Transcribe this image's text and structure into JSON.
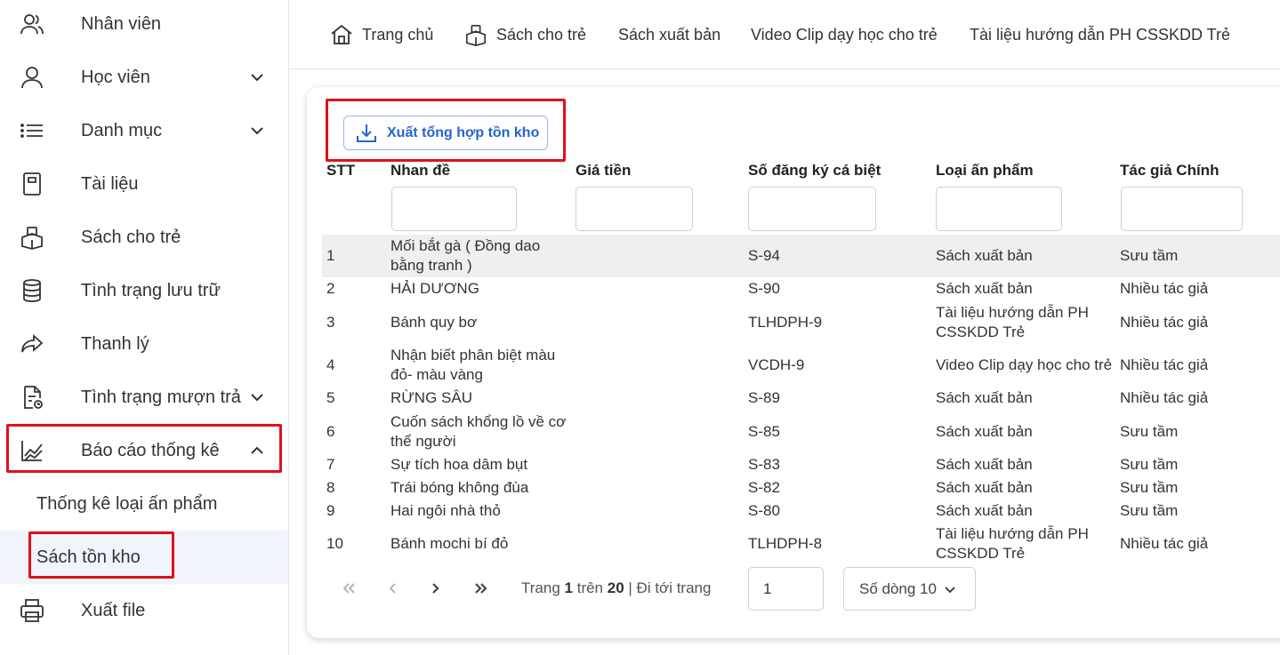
{
  "sidebar": {
    "items": [
      {
        "label": "Nhân viên",
        "icon": "users-icon"
      },
      {
        "label": "Học viên",
        "icon": "user-icon"
      },
      {
        "label": "Danh mục",
        "icon": "list-icon"
      },
      {
        "label": "Tài liệu",
        "icon": "document-icon"
      },
      {
        "label": "Sách cho trẻ",
        "icon": "book-stack-icon"
      },
      {
        "label": "Tình trạng lưu trữ",
        "icon": "database-icon"
      },
      {
        "label": "Thanh lý",
        "icon": "share-arrow-icon"
      },
      {
        "label": "Tình trạng mượn trả",
        "icon": "file-status-icon"
      },
      {
        "label": "Báo cáo thống kê",
        "icon": "chart-icon"
      },
      {
        "label": "Xuất file",
        "icon": "printer-icon"
      }
    ],
    "sub_items": [
      {
        "label": "Thống kê loại ấn phẩm"
      },
      {
        "label": "Sách tồn kho"
      }
    ]
  },
  "topnav": {
    "home": "Trang chủ",
    "kids_books": "Sách cho trẻ",
    "published": "Sách xuất bản",
    "video": "Video Clip dạy học cho trẻ",
    "guide": "Tài liệu hướng dẫn PH CSSKDD Trẻ"
  },
  "export_button": "Xuất tổng hợp tồn kho",
  "table": {
    "headers": {
      "stt": "STT",
      "title": "Nhan đề",
      "price": "Giá tiền",
      "reg_no": "Số đăng ký cá biệt",
      "type": "Loại ấn phẩm",
      "author": "Tác giả Chính"
    },
    "rows": [
      {
        "stt": "1",
        "title1": "Mối bắt gà ( Đồng dao",
        "title2": "bằng tranh )",
        "reg": "S-94",
        "type1": "Sách xuất bản",
        "type2": "",
        "author": "Sưu tầm"
      },
      {
        "stt": "2",
        "title1": "HẢI DƯƠNG",
        "title2": "",
        "reg": "S-90",
        "type1": "Sách xuất bản",
        "type2": "",
        "author": "Nhiều tác giả"
      },
      {
        "stt": "3",
        "title1": "Bánh quy bơ",
        "title2": "",
        "reg": "TLHDPH-9",
        "type1": "Tài liệu hướng dẫn PH",
        "type2": "CSSKDD Trẻ",
        "author": "Nhiều tác giả"
      },
      {
        "stt": "4",
        "title1": "Nhận biết phân biệt màu",
        "title2": "đỏ- màu vàng",
        "reg": "VCDH-9",
        "type1": "Video Clip dạy học cho trẻ",
        "type2": "",
        "author": "Nhiều tác giả"
      },
      {
        "stt": "5",
        "title1": "RỪNG SÂU",
        "title2": "",
        "reg": "S-89",
        "type1": "Sách xuất bản",
        "type2": "",
        "author": "Nhiều tác giả"
      },
      {
        "stt": "6",
        "title1": "Cuốn sách khổng lồ về cơ",
        "title2": "thể người",
        "reg": "S-85",
        "type1": "Sách xuất bản",
        "type2": "",
        "author": "Sưu tầm"
      },
      {
        "stt": "7",
        "title1": "Sự tích hoa dâm bụt",
        "title2": "",
        "reg": "S-83",
        "type1": "Sách xuất bản",
        "type2": "",
        "author": "Sưu tầm"
      },
      {
        "stt": "8",
        "title1": "Trái bóng không đùa",
        "title2": "",
        "reg": "S-82",
        "type1": "Sách xuất bản",
        "type2": "",
        "author": "Sưu tầm"
      },
      {
        "stt": "9",
        "title1": "Hai ngôi nhà thỏ",
        "title2": "",
        "reg": "S-80",
        "type1": "Sách xuất bản",
        "type2": "",
        "author": "Sưu tầm"
      },
      {
        "stt": "10",
        "title1": "Bánh mochi bí đỏ",
        "title2": "",
        "reg": "TLHDPH-8",
        "type1": "Tài liệu hướng dẫn PH",
        "type2": "CSSKDD Trẻ",
        "author": "Nhiều tác giả"
      }
    ]
  },
  "pagination": {
    "page_word": "Trang",
    "current": "1",
    "of_word": "trên",
    "total": "20",
    "goto": "| Đi tới trang",
    "input_value": "1",
    "rows_label": "Số dòng 10"
  },
  "colors": {
    "accent": "#2563d6",
    "highlight": "#e0101a",
    "active_bg": "#f1f4fb"
  }
}
